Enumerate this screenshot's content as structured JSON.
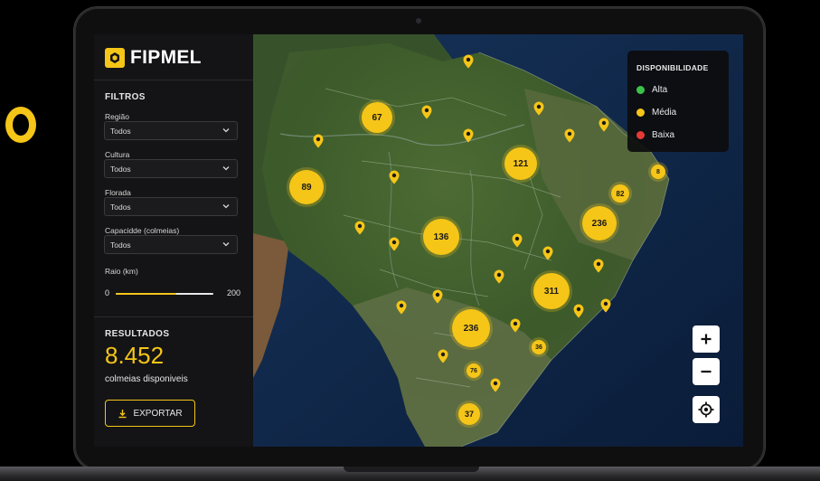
{
  "app": {
    "name": "FIPMEL"
  },
  "filters": {
    "title": "FILTROS",
    "region": {
      "label": "Região",
      "value": "Todos"
    },
    "culture": {
      "label": "Cultura",
      "value": "Todos"
    },
    "bloom": {
      "label": "Florada",
      "value": "Todos"
    },
    "capacity": {
      "label": "Capacidde (colmeias)",
      "value": "Todos"
    },
    "radius": {
      "label": "Raio (km)",
      "min": "0",
      "max": "200",
      "fraction": 0.62
    }
  },
  "results": {
    "title": "RESULTADOS",
    "value": "8.452",
    "subtitle": "colmeias disponiveis"
  },
  "export": {
    "label": "EXPORTAR"
  },
  "legend": {
    "title": "DISPONIBILIDADE",
    "items": [
      {
        "label": "Alta",
        "color": "#3cc14a"
      },
      {
        "label": "Média",
        "color": "#f5c518"
      },
      {
        "label": "Baixa",
        "color": "#e53935"
      }
    ]
  },
  "clusters": [
    "67",
    "121",
    "89",
    "136",
    "236",
    "311",
    "236",
    "37"
  ],
  "small_markers": [
    "82",
    "8",
    "36",
    "76"
  ],
  "map_controls": {
    "zoom_in": "+",
    "zoom_out": "−"
  },
  "colors": {
    "accent": "#f5c518",
    "sidebar_bg": "#141416",
    "ocean": "#0d2445",
    "land": "#3a5a2a"
  }
}
